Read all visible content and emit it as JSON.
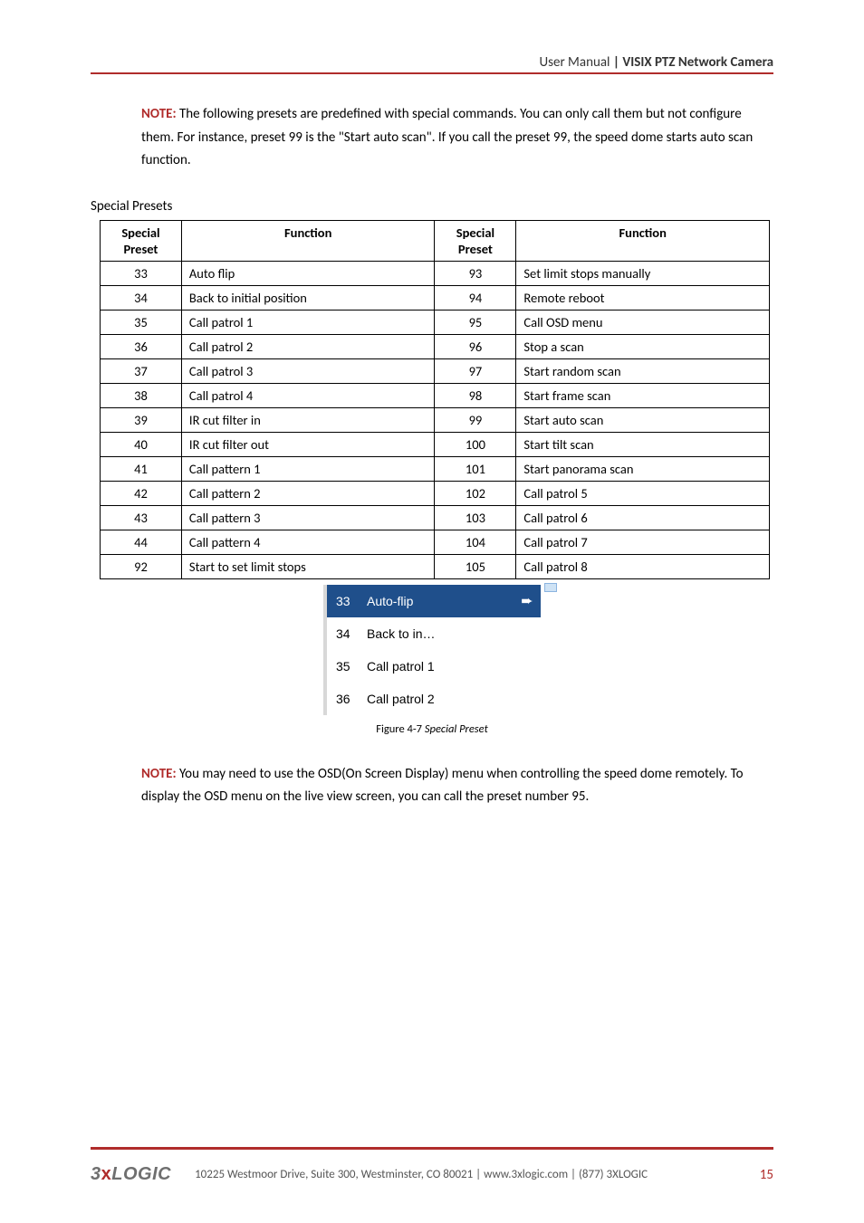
{
  "header": {
    "left_light": "User Manual ",
    "left_bold": "| VISIX PTZ Network Camera"
  },
  "note1": {
    "label": "NOTE:",
    "text": " The following presets are predefined with special commands. You can only call them but not configure them. For instance, preset 99 is the \"Start auto scan\". If you call the preset 99, the speed dome starts auto scan function."
  },
  "table": {
    "title": "Special Presets",
    "headers": {
      "preset": "Special Preset",
      "function": "Function"
    },
    "rows": [
      {
        "p1": "33",
        "f1": "Auto flip",
        "p2": "93",
        "f2": "Set limit stops manually"
      },
      {
        "p1": "34",
        "f1": "Back to initial position",
        "p2": "94",
        "f2": "Remote reboot"
      },
      {
        "p1": "35",
        "f1": "Call patrol 1",
        "p2": "95",
        "f2": "Call OSD menu"
      },
      {
        "p1": "36",
        "f1": "Call patrol 2",
        "p2": "96",
        "f2": "Stop a scan"
      },
      {
        "p1": "37",
        "f1": "Call patrol 3",
        "p2": "97",
        "f2": "Start random scan"
      },
      {
        "p1": "38",
        "f1": "Call patrol 4",
        "p2": "98",
        "f2": "Start frame scan"
      },
      {
        "p1": "39",
        "f1": "IR cut filter in",
        "p2": "99",
        "f2": "Start auto scan"
      },
      {
        "p1": "40",
        "f1": "IR cut filter out",
        "p2": "100",
        "f2": "Start tilt scan"
      },
      {
        "p1": "41",
        "f1": "Call pattern 1",
        "p2": "101",
        "f2": "Start panorama scan"
      },
      {
        "p1": "42",
        "f1": "Call pattern 2",
        "p2": "102",
        "f2": "Call patrol 5"
      },
      {
        "p1": "43",
        "f1": "Call pattern 3",
        "p2": "103",
        "f2": "Call patrol 6"
      },
      {
        "p1": "44",
        "f1": "Call pattern 4",
        "p2": "104",
        "f2": "Call patrol 7"
      },
      {
        "p1": "92",
        "f1": "Start to set limit stops",
        "p2": "105",
        "f2": "Call patrol 8"
      }
    ]
  },
  "figure": {
    "rows": [
      {
        "num": "33",
        "label": "Auto-flip",
        "selected": true,
        "arrow": "➨"
      },
      {
        "num": "34",
        "label": "Back to in…",
        "selected": false,
        "arrow": ""
      },
      {
        "num": "35",
        "label": "Call patrol 1",
        "selected": false,
        "arrow": ""
      },
      {
        "num": "36",
        "label": "Call patrol 2",
        "selected": false,
        "arrow": ""
      }
    ],
    "caption_prefix": "Figure 4-7 ",
    "caption_italic": "Special Preset"
  },
  "note2": {
    "label": "NOTE:",
    "text": " You may need to use the OSD(On Screen Display) menu when controlling the speed dome remotely. To display the OSD menu on the live view screen, you can call the preset number 95."
  },
  "footer": {
    "logo_pre": "3",
    "logo_x": "x",
    "logo_post": "LOGIC",
    "address": "10225 Westmoor Drive, Suite 300, Westminster, CO 80021 | www.3xlogic.com | (877) 3XLOGIC",
    "page": "15"
  }
}
